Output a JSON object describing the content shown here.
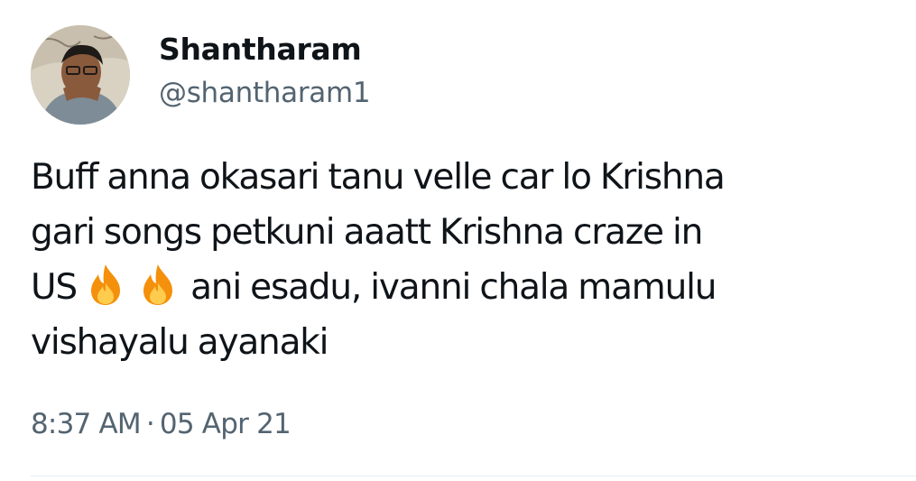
{
  "author": {
    "display_name": "Shantharam",
    "handle": "@shantharam1"
  },
  "tweet": {
    "lines": [
      "Buff anna okasari tanu velle car lo Krishna",
      "gari songs petkuni aaatt Krishna craze in",
      "US",
      "ani esadu, ivanni chala mamulu",
      "vishayalu ayanaki"
    ],
    "emojis": [
      "fire-icon",
      "fire-icon"
    ]
  },
  "meta": {
    "time": "8:37 AM",
    "separator": "·",
    "date": "05 Apr 21"
  },
  "colors": {
    "text": "#0f1419",
    "secondary": "#536471",
    "divider": "#e6ecf0"
  }
}
